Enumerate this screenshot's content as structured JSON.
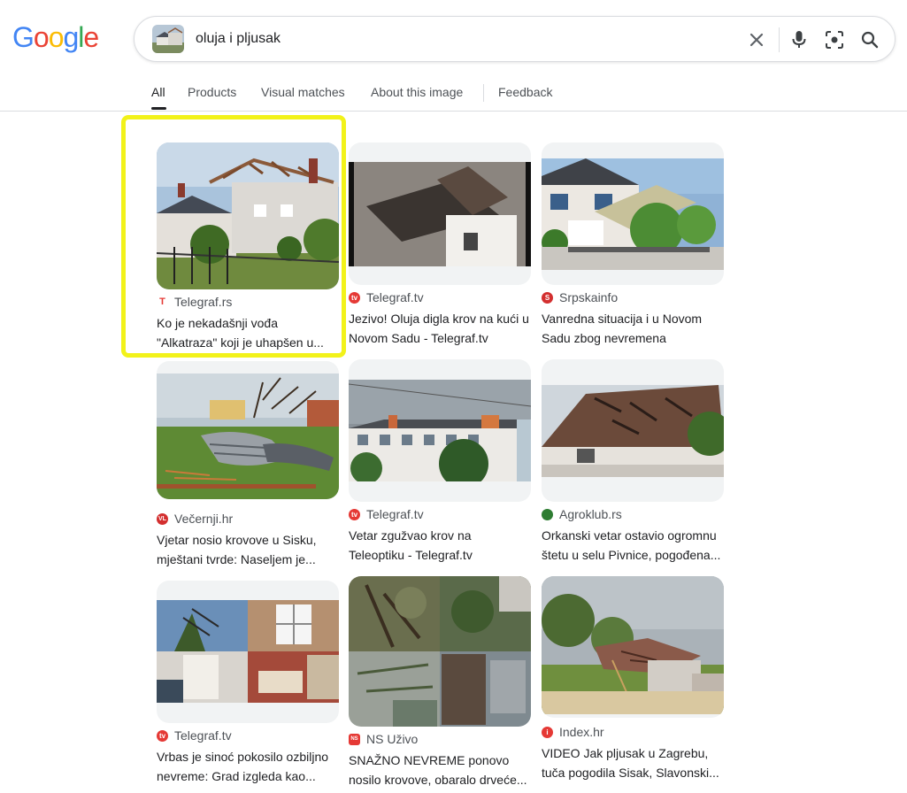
{
  "header": {
    "logo_letters": [
      "G",
      "o",
      "o",
      "g",
      "l",
      "e"
    ],
    "logo_colors": [
      "#4285f4",
      "#ea4335",
      "#fbbc05",
      "#4285f4",
      "#34a853",
      "#ea4335"
    ],
    "search_query": "oluja i pljusak",
    "icons": [
      "close-icon",
      "microphone-icon",
      "lens-icon",
      "search-icon"
    ]
  },
  "tabs": [
    {
      "label": "All",
      "active": true
    },
    {
      "label": "Products",
      "active": false
    },
    {
      "label": "Visual matches",
      "active": false
    },
    {
      "label": "About this image",
      "active": false
    },
    {
      "label": "Feedback",
      "active": false
    }
  ],
  "results": [
    {
      "source": "Telegraf.rs",
      "title_line1": "Ko je nekadašnji vođa",
      "title_line2": "\"Alkatraza\" koji je uhapšen u...",
      "favicon_color": "#e53935",
      "favicon_letter": "T",
      "highlighted": true
    },
    {
      "source": "Telegraf.tv",
      "title_line1": "Jezivo! Oluja digla krov na kući u",
      "title_line2": "Novom Sadu - Telegraf.tv",
      "favicon_color": "#e53935",
      "favicon_letter": "tv"
    },
    {
      "source": "Srpskainfo",
      "title_line1": "Vanredna situacija i u Novom",
      "title_line2": "Sadu zbog nevremena",
      "favicon_color": "#d32f2f",
      "favicon_letter": "S"
    },
    {
      "source": "Večernji.hr",
      "title_line1": "Vjetar nosio krovove u Sisku,",
      "title_line2": "mještani tvrde: Naseljem je...",
      "favicon_color": "#d32f2f",
      "favicon_letter": "VL"
    },
    {
      "source": "Telegraf.tv",
      "title_line1": "Vetar zgužvao krov na",
      "title_line2": "Teleoptiku - Telegraf.tv",
      "favicon_color": "#e53935",
      "favicon_letter": "tv"
    },
    {
      "source": "Agroklub.rs",
      "title_line1": "Orkanski vetar ostavio ogromnu",
      "title_line2": "štetu u selu Pivnice, pogođena...",
      "favicon_color": "#2e7d32",
      "favicon_letter": ""
    },
    {
      "source": "Telegraf.tv",
      "title_line1": "Vrbas je sinoć pokosilo ozbiljno",
      "title_line2": "nevreme: Grad izgleda kao...",
      "favicon_color": "#e53935",
      "favicon_letter": "tv"
    },
    {
      "source": "NS Uživo",
      "title_line1": "SNAŽNO NEVREME ponovo",
      "title_line2": "nosilo krovove, obaralo drveće...",
      "favicon_color": "#e53935",
      "favicon_letter": "NS"
    },
    {
      "source": "Index.hr",
      "title_line1": "VIDEO Jak pljusak u Zagrebu,",
      "title_line2": "tuča pogodila Sisak, Slavonski...",
      "favicon_color": "#e53935",
      "favicon_letter": "i"
    }
  ]
}
